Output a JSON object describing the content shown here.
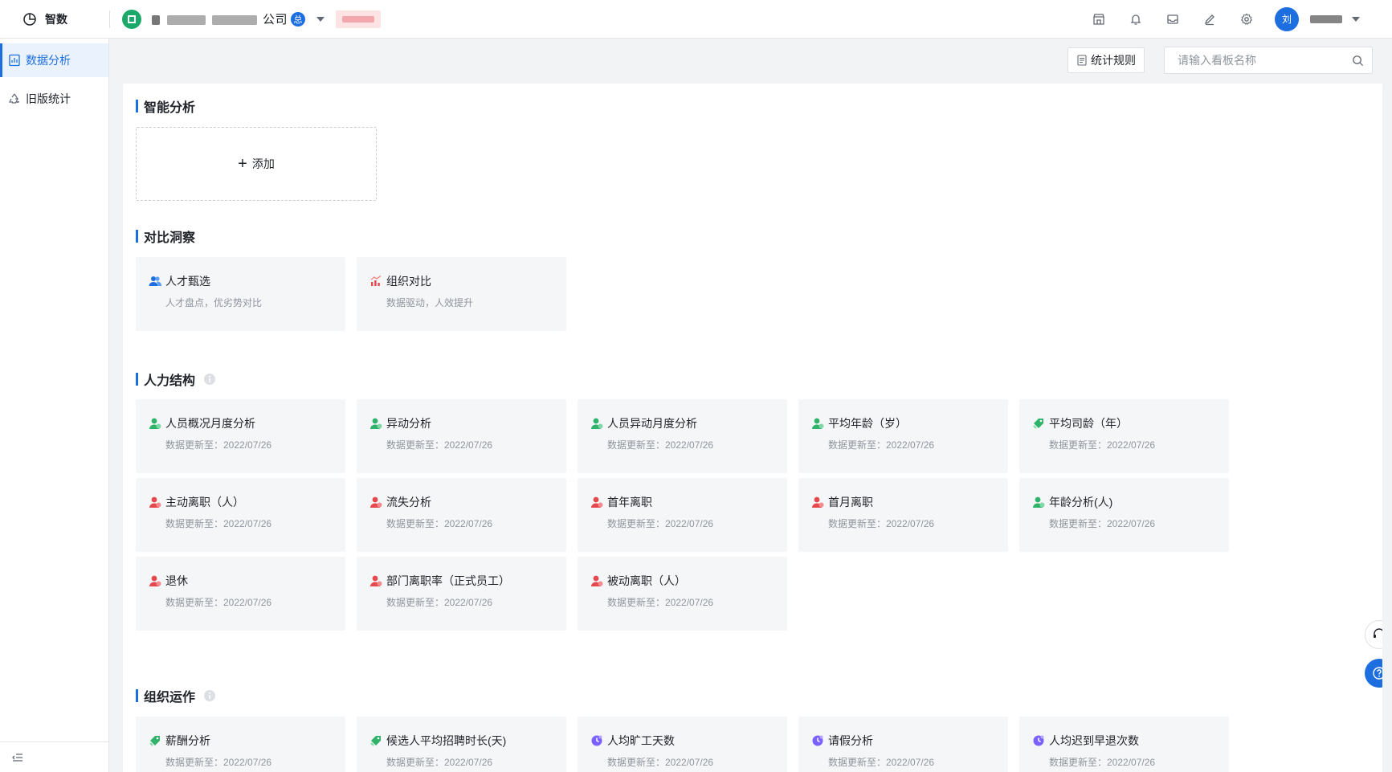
{
  "app": {
    "title": "智数"
  },
  "company": {
    "name_visible": "公司",
    "badge": "总"
  },
  "topbar": {
    "icons": [
      "store-icon",
      "bell-icon",
      "inbox-icon",
      "edit-icon",
      "gear-icon"
    ],
    "avatar_text": "刘"
  },
  "sidebar": {
    "items": [
      {
        "label": "数据分析",
        "icon": "dashboard-icon",
        "active": true
      },
      {
        "label": "旧版统计",
        "icon": "recycle-icon",
        "active": false
      }
    ]
  },
  "toolbar": {
    "rule_label": "统计规则",
    "search_placeholder": "请输入看板名称"
  },
  "sections": {
    "smart": {
      "title": "智能分析",
      "add_label": "添加"
    },
    "compare": {
      "title": "对比洞察",
      "cards": [
        {
          "title": "人才甄选",
          "sub": "人才盘点，优劣势对比",
          "icon": "people-blue-icon"
        },
        {
          "title": "组织对比",
          "sub": "数据驱动，人效提升",
          "icon": "chart-red-icon"
        }
      ]
    },
    "structure": {
      "title": "人力结构",
      "cards": [
        {
          "title": "人员概况月度分析",
          "sub": "数据更新至：2022/07/26",
          "icon": "person-green-icon"
        },
        {
          "title": "异动分析",
          "sub": "数据更新至：2022/07/26",
          "icon": "person-green-icon"
        },
        {
          "title": "人员异动月度分析",
          "sub": "数据更新至：2022/07/26",
          "icon": "person-green-icon"
        },
        {
          "title": "平均年龄（岁）",
          "sub": "数据更新至：2022/07/26",
          "icon": "person-green-icon"
        },
        {
          "title": "平均司龄（年）",
          "sub": "数据更新至：2022/07/26",
          "icon": "tag-green-icon"
        },
        {
          "title": "主动离职（人）",
          "sub": "数据更新至：2022/07/26",
          "icon": "person-red-icon"
        },
        {
          "title": "流失分析",
          "sub": "数据更新至：2022/07/26",
          "icon": "person-red-icon"
        },
        {
          "title": "首年离职",
          "sub": "数据更新至：2022/07/26",
          "icon": "person-red-icon"
        },
        {
          "title": "首月离职",
          "sub": "数据更新至：2022/07/26",
          "icon": "person-red-icon"
        },
        {
          "title": "年龄分析(人)",
          "sub": "数据更新至：2022/07/26",
          "icon": "person-green-icon"
        },
        {
          "title": "退休",
          "sub": "数据更新至：2022/07/26",
          "icon": "person-red-icon"
        },
        {
          "title": "部门离职率（正式员工）",
          "sub": "数据更新至：2022/07/26",
          "icon": "person-red-icon"
        },
        {
          "title": "被动离职（人）",
          "sub": "数据更新至：2022/07/26",
          "icon": "person-red-icon"
        }
      ]
    },
    "operation": {
      "title": "组织运作",
      "cards": [
        {
          "title": "薪酬分析",
          "sub": "数据更新至：2022/07/26",
          "icon": "tag-green-icon"
        },
        {
          "title": "候选人平均招聘时长(天)",
          "sub": "数据更新至：2022/07/26",
          "icon": "tag-green-icon"
        },
        {
          "title": "人均旷工天数",
          "sub": "数据更新至：2022/07/26",
          "icon": "clock-purple-icon"
        },
        {
          "title": "请假分析",
          "sub": "数据更新至：2022/07/26",
          "icon": "clock-purple-icon"
        },
        {
          "title": "人均迟到早退次数",
          "sub": "数据更新至：2022/07/26",
          "icon": "clock-purple-icon"
        }
      ]
    }
  },
  "colors": {
    "accent": "#1d6fe0",
    "green": "#2fb36b",
    "red": "#e5484d",
    "purple": "#7b61ff",
    "card_bg": "#f5f6f7"
  }
}
